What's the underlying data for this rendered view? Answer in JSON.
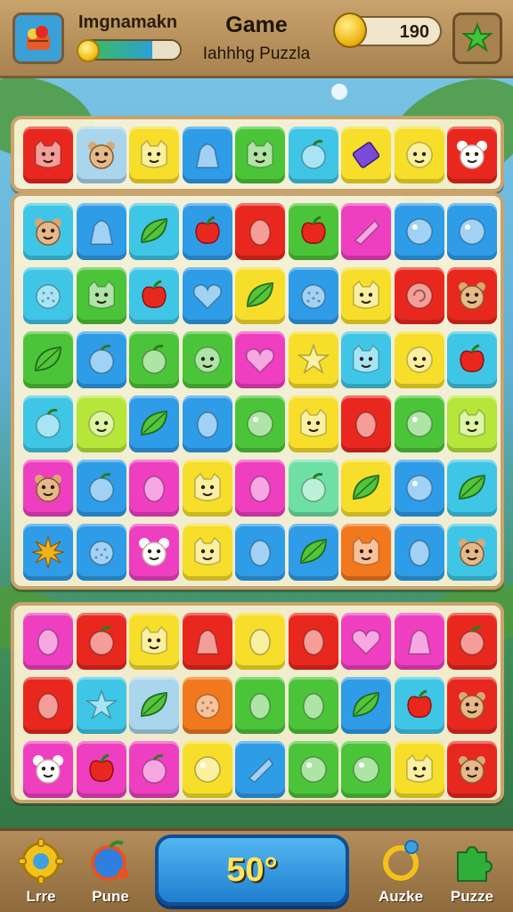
{
  "header": {
    "player_name": "Imgnamakn",
    "progress": 0.72,
    "title": "Game",
    "subtitle": "Iahhhg Puzzla",
    "score": "190"
  },
  "colors": {
    "red": "#e8281e",
    "yellow": "#f6de2a",
    "green": "#4cc43a",
    "blue": "#2f9ce8",
    "pink": "#ee3fc0",
    "lightblue": "#a9d6ec",
    "cyan": "#3fc6e6",
    "orange": "#f2781e",
    "lime": "#b6e63a",
    "mint": "#6ee0a6",
    "magenta": "#d83acc"
  },
  "boards": [
    {
      "rows": [
        [
          {
            "c": "red",
            "i": "cat-face"
          },
          {
            "c": "lightblue",
            "i": "bear-face"
          },
          {
            "c": "yellow",
            "i": "cat-face"
          },
          {
            "c": "blue",
            "i": "bag"
          },
          {
            "c": "green",
            "i": "cat-face"
          },
          {
            "c": "cyan",
            "i": "fruit"
          },
          {
            "c": "yellow",
            "i": "battery"
          },
          {
            "c": "yellow",
            "i": "smile"
          },
          {
            "c": "red",
            "i": "mouse-face"
          }
        ]
      ]
    },
    {
      "rows": [
        [
          {
            "c": "cyan",
            "i": "bear-face"
          },
          {
            "c": "blue",
            "i": "bag"
          },
          {
            "c": "cyan",
            "i": "leaf"
          },
          {
            "c": "blue",
            "i": "apple"
          },
          {
            "c": "red",
            "i": "egg"
          },
          {
            "c": "green",
            "i": "apple"
          },
          {
            "c": "pink",
            "i": "candy"
          },
          {
            "c": "blue",
            "i": "ball"
          },
          {
            "c": "blue",
            "i": "ball"
          }
        ],
        [
          {
            "c": "cyan",
            "i": "berry"
          },
          {
            "c": "green",
            "i": "cat-face"
          },
          {
            "c": "cyan",
            "i": "apple"
          },
          {
            "c": "blue",
            "i": "heart"
          },
          {
            "c": "yellow",
            "i": "leaf"
          },
          {
            "c": "blue",
            "i": "berry"
          },
          {
            "c": "yellow",
            "i": "cat-face"
          },
          {
            "c": "red",
            "i": "swirl"
          },
          {
            "c": "red",
            "i": "bear-face"
          }
        ],
        [
          {
            "c": "green",
            "i": "leaf"
          },
          {
            "c": "blue",
            "i": "fruit"
          },
          {
            "c": "green",
            "i": "fruit"
          },
          {
            "c": "green",
            "i": "smile"
          },
          {
            "c": "pink",
            "i": "heart"
          },
          {
            "c": "yellow",
            "i": "star"
          },
          {
            "c": "cyan",
            "i": "cat-face"
          },
          {
            "c": "yellow",
            "i": "smile"
          },
          {
            "c": "cyan",
            "i": "apple"
          }
        ],
        [
          {
            "c": "cyan",
            "i": "fruit"
          },
          {
            "c": "lime",
            "i": "smile"
          },
          {
            "c": "blue",
            "i": "leaf"
          },
          {
            "c": "blue",
            "i": "egg"
          },
          {
            "c": "green",
            "i": "ball"
          },
          {
            "c": "yellow",
            "i": "cat-face"
          },
          {
            "c": "red",
            "i": "egg"
          },
          {
            "c": "green",
            "i": "ball"
          },
          {
            "c": "lime",
            "i": "cat-face"
          }
        ],
        [
          {
            "c": "pink",
            "i": "bear-face"
          },
          {
            "c": "blue",
            "i": "fruit"
          },
          {
            "c": "pink",
            "i": "egg"
          },
          {
            "c": "yellow",
            "i": "cat-face"
          },
          {
            "c": "pink",
            "i": "egg"
          },
          {
            "c": "mint",
            "i": "fruit"
          },
          {
            "c": "yellow",
            "i": "leaf"
          },
          {
            "c": "blue",
            "i": "ball"
          },
          {
            "c": "cyan",
            "i": "leaf"
          }
        ],
        [
          {
            "c": "blue",
            "i": "burst"
          },
          {
            "c": "blue",
            "i": "berry"
          },
          {
            "c": "pink",
            "i": "mouse-face"
          },
          {
            "c": "yellow",
            "i": "cat-face"
          },
          {
            "c": "blue",
            "i": "egg"
          },
          {
            "c": "blue",
            "i": "leaf"
          },
          {
            "c": "orange",
            "i": "cat-face"
          },
          {
            "c": "blue",
            "i": "egg"
          },
          {
            "c": "cyan",
            "i": "bear-face"
          }
        ]
      ]
    },
    {
      "rows": [
        [
          {
            "c": "pink",
            "i": "egg"
          },
          {
            "c": "red",
            "i": "fruit"
          },
          {
            "c": "yellow",
            "i": "cat-face"
          },
          {
            "c": "red",
            "i": "bag"
          },
          {
            "c": "yellow",
            "i": "egg"
          },
          {
            "c": "red",
            "i": "egg"
          },
          {
            "c": "pink",
            "i": "heart"
          },
          {
            "c": "pink",
            "i": "bag"
          },
          {
            "c": "red",
            "i": "fruit"
          }
        ],
        [
          {
            "c": "red",
            "i": "egg"
          },
          {
            "c": "cyan",
            "i": "star"
          },
          {
            "c": "lightblue",
            "i": "leaf"
          },
          {
            "c": "orange",
            "i": "berry"
          },
          {
            "c": "green",
            "i": "egg"
          },
          {
            "c": "green",
            "i": "egg"
          },
          {
            "c": "blue",
            "i": "leaf"
          },
          {
            "c": "cyan",
            "i": "apple"
          },
          {
            "c": "red",
            "i": "bear-face"
          }
        ],
        [
          {
            "c": "pink",
            "i": "mouse-face"
          },
          {
            "c": "pink",
            "i": "apple"
          },
          {
            "c": "pink",
            "i": "fruit"
          },
          {
            "c": "yellow",
            "i": "ball"
          },
          {
            "c": "blue",
            "i": "candy"
          },
          {
            "c": "green",
            "i": "ball"
          },
          {
            "c": "green",
            "i": "ball"
          },
          {
            "c": "yellow",
            "i": "cat-face"
          },
          {
            "c": "red",
            "i": "bear-face"
          }
        ]
      ]
    }
  ],
  "bottom_nav": {
    "left1_label": "Lrre",
    "left2_label": "Pune",
    "center_label": "50°",
    "right1_label": "Auzke",
    "right2_label": "Puzze"
  }
}
